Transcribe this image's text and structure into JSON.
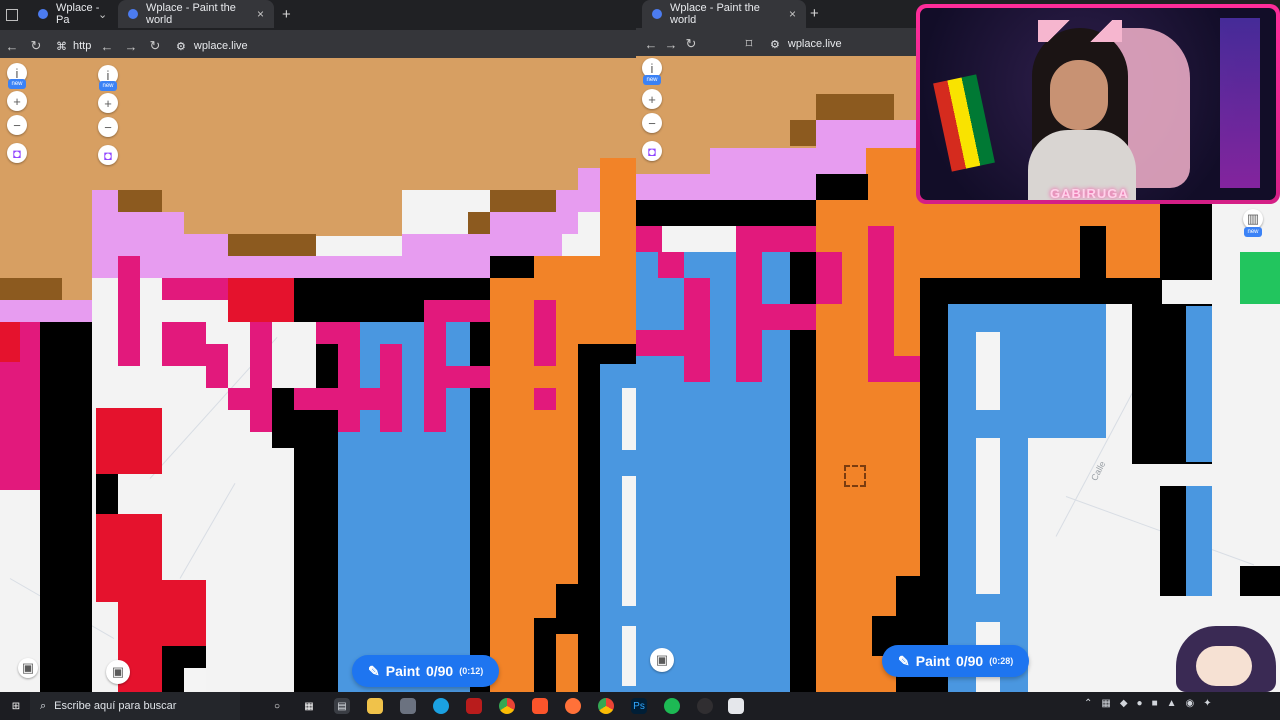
{
  "browser_left": {
    "tabs": [
      {
        "title": "Wplace - Pa"
      },
      {
        "title": "Wplace - Paint the world"
      }
    ],
    "partial_url": "http",
    "url": "wplace.live",
    "new_tab_label": "+",
    "close_label": "×"
  },
  "browser_right": {
    "tab_title": "Wplace - Paint the world",
    "url": "wplace.live",
    "new_tab_label": "+",
    "close_label": "×"
  },
  "paint_buttons": [
    {
      "label": "Paint",
      "count": "0/90",
      "timer": "(0:12)"
    },
    {
      "label": "Paint",
      "count": "0/90",
      "timer": "(0:28)"
    }
  ],
  "side_controls": {
    "new_badge": "new"
  },
  "stream_overlay": {
    "nameplate": "GABIRUGA"
  },
  "map_labels": {
    "street": "Calle"
  },
  "taskbar": {
    "search_placeholder": "Escribe aquí para buscar"
  },
  "colors": {
    "sand": "#d79f62",
    "pink_light": "#e79cf0",
    "magenta": "#e2197c",
    "red": "#e5122d",
    "orange": "#f28328",
    "blue": "#4a97e0",
    "black": "#000000",
    "white": "#f4f4f4",
    "brown": "#8c5a1f"
  }
}
